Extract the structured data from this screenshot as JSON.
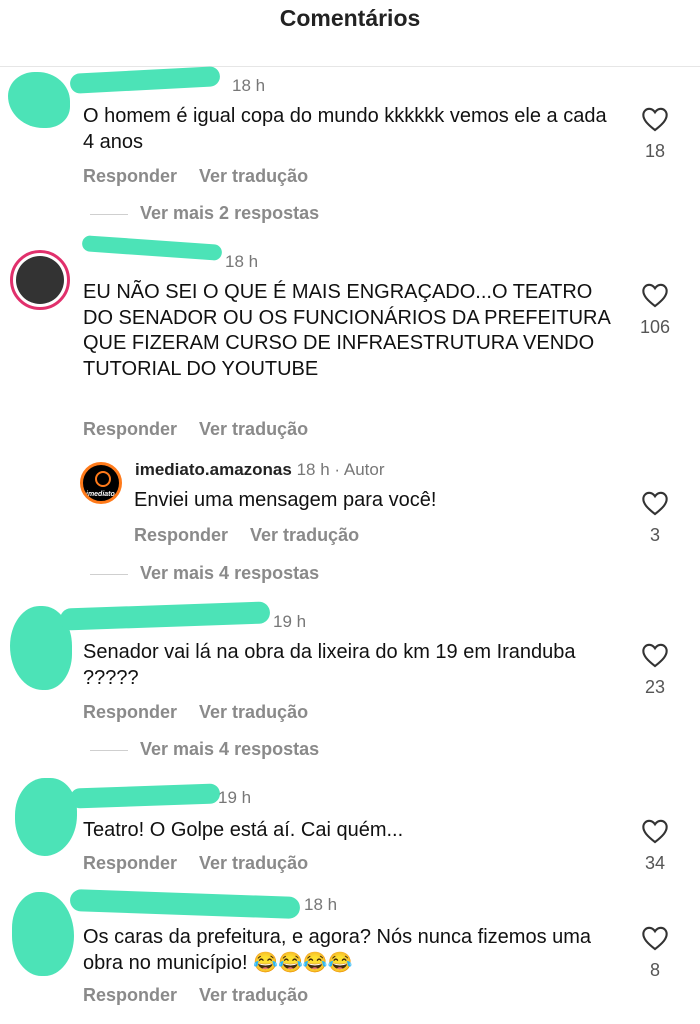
{
  "header": {
    "title": "Comentários"
  },
  "comments": [
    {
      "time": "18 h",
      "text": "O homem é igual copa do mundo kkkkkk vemos ele a cada 4 anos",
      "reply_label": "Responder",
      "translate_label": "Ver tradução",
      "likes": "18",
      "more_replies": "Ver mais 2 respostas"
    },
    {
      "time": "18 h",
      "text": "EU NÃO SEI O QUE É MAIS ENGRAÇADO...O TEATRO DO SENADOR OU OS FUNCIONÁRIOS DA PREFEITURA QUE FIZERAM CURSO DE INFRAESTRUTURA VENDO TUTORIAL DO YOUTUBE",
      "reply_label": "Responder",
      "translate_label": "Ver tradução",
      "likes": "106",
      "reply": {
        "username": "imediato.amazonas",
        "time": "18 h",
        "author_tag": "Autor",
        "avatar_text": "imediato",
        "text": "Enviei uma mensagem para você!",
        "reply_label": "Responder",
        "translate_label": "Ver tradução",
        "likes": "3"
      },
      "more_replies": "Ver mais 4 respostas"
    },
    {
      "time": "19 h",
      "text": "Senador vai lá na obra da lixeira do km 19 em Iranduba ?????",
      "reply_label": "Responder",
      "translate_label": "Ver tradução",
      "likes": "23",
      "more_replies": "Ver mais 4 respostas"
    },
    {
      "time": "19 h",
      "text": "Teatro! O Golpe está aí. Cai quém...",
      "reply_label": "Responder",
      "translate_label": "Ver tradução",
      "likes": "34"
    },
    {
      "time": "18 h",
      "text": "Os caras da prefeitura, e agora? Nós nunca fizemos uma obra no município! 😂😂😂😂",
      "reply_label": "Responder",
      "translate_label": "Ver tradução",
      "likes": "8"
    }
  ],
  "colors": {
    "redaction": "#4ce3b7",
    "story_ring": "#e1306c",
    "muted_text": "#8a8a8a"
  },
  "icons": {
    "like": "heart-outline-icon"
  }
}
